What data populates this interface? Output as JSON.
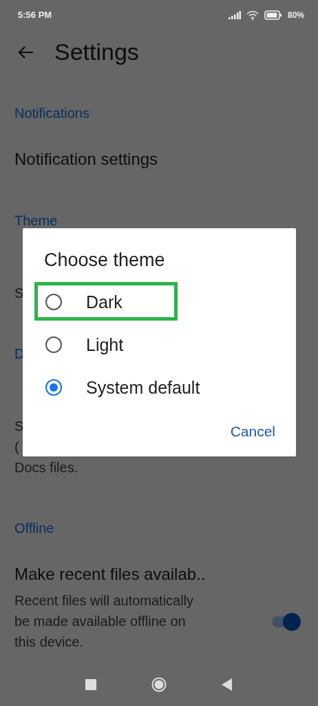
{
  "status_bar": {
    "time": "5:56 PM",
    "battery": "80%"
  },
  "app_bar": {
    "title": "Settings"
  },
  "sections": [
    {
      "header": "Notifications",
      "items": [
        {
          "kind": "link",
          "title": "Notification settings"
        }
      ]
    },
    {
      "header": "Theme",
      "items": [
        {
          "kind": "link",
          "lines": [
            "S"
          ]
        }
      ]
    },
    {
      "header": "D",
      "items": [
        {
          "kind": "link",
          "lines": [
            "S",
            "(",
            "Docs files."
          ]
        }
      ]
    },
    {
      "header": "Offline",
      "items": [
        {
          "kind": "toggle",
          "title": "Make recent files availab..",
          "lines": [
            "Recent files will automatically",
            "be made available offline on",
            "this device."
          ],
          "on": true
        }
      ]
    }
  ],
  "dialog": {
    "title": "Choose theme",
    "options": [
      {
        "label": "Dark",
        "selected": false,
        "highlighted": true
      },
      {
        "label": "Light",
        "selected": false,
        "highlighted": false
      },
      {
        "label": "System default",
        "selected": true,
        "highlighted": false
      }
    ],
    "buttons": [
      "Cancel"
    ]
  }
}
